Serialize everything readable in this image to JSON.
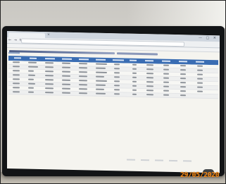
{
  "photo": {
    "timestamp": "29/05/2020"
  }
}
